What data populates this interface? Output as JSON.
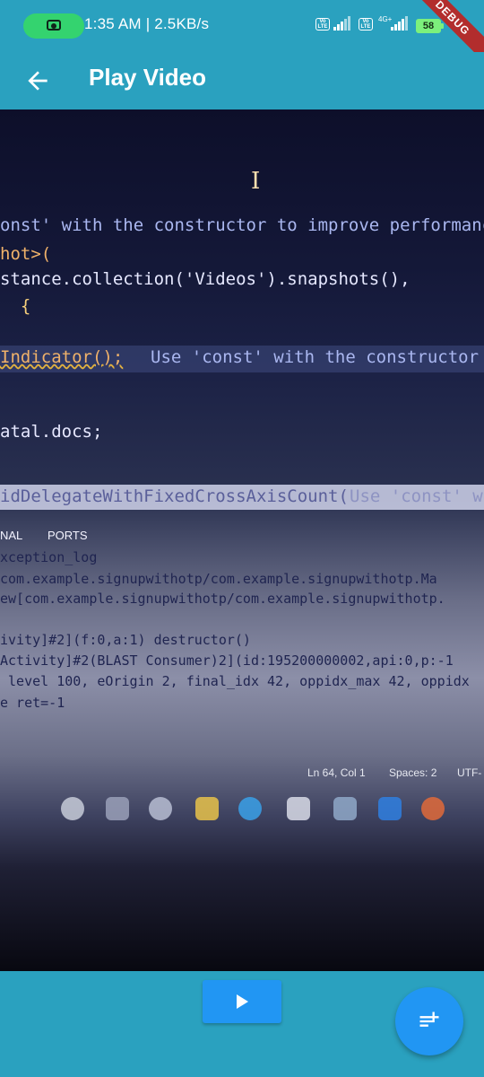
{
  "status_bar": {
    "time_speed": "1:35 AM | 2.5KB/s",
    "volte_label": "Vo LTE",
    "network_type": "4G+",
    "battery_level": "58",
    "debug_banner": "DEBUG"
  },
  "app_bar": {
    "title": "Play Video",
    "back_icon": "arrow-left-icon"
  },
  "video_frame": {
    "code_lines": [
      "onst' with the constructor to improve performance",
      "hot>(",
      "stance.collection('Videos').snapshots(),",
      "  {",
      "Indicator();",
      "Use 'const' with the constructor to",
      "atal.docs;",
      "idDelegateWithFixedCrossAxisCount(",
      "Use 'const' wit"
    ],
    "panel_tabs": [
      "NAL",
      "PORTS"
    ],
    "terminal_lines": [
      "xception_log",
      "com.example.signupwithotp/com.example.signupwithotp.Ma",
      "ew[com.example.signupwithotp/com.example.signupwithotp.",
      "ivity]#2](f:0,a:1) destructor()",
      "Activity]#2(BLAST Consumer)2](id:195200000002,api:0,p:-1",
      " level 100, eOrigin 2, final_idx 42, oppidx_max 42, oppidx",
      "e ret=-1"
    ],
    "editor_status": [
      "Ln 64, Col 1",
      "Spaces: 2",
      "UTF-"
    ]
  },
  "controls": {
    "play_icon": "play-icon",
    "fab_icon": "note-add-icon"
  },
  "colors": {
    "primary": "#2aa1bf",
    "button_blue": "#2196f3",
    "camera_pill": "#34d36f",
    "debug_red": "#b22d2d"
  }
}
